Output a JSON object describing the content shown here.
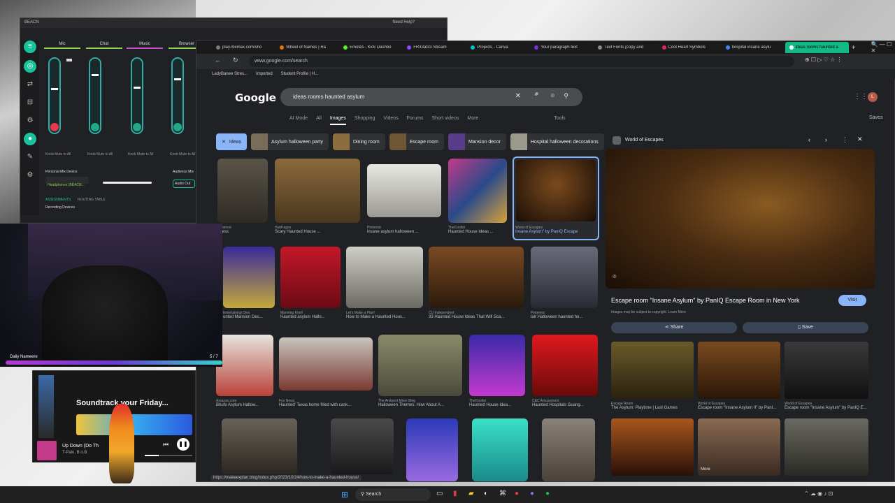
{
  "mixer": {
    "title": "BEACN",
    "help": "Need Help?",
    "channels": [
      "Mic",
      "Chat",
      "Music",
      "Browser"
    ],
    "bottom_labels": [
      "Personal Mix Device",
      "Headphones (BEACN...",
      "Audience Mix",
      "Audio Out",
      "ASSIGNMENTS",
      "ROUTING TABLE",
      "Recording Devices"
    ],
    "small_labels": [
      "Knob Mute to All",
      "Knob Mute to All",
      "Knob Mute to All",
      "Knob Mute to All"
    ]
  },
  "browser": {
    "tabs": [
      {
        "label": "play.rbxmax.com/sho",
        "color": "#7a7a7a"
      },
      {
        "label": "Wheel of Names | Ra",
        "color": "#e8710a"
      },
      {
        "label": "Emotes - Kick Dashbo",
        "color": "#53fc18"
      },
      {
        "label": "FR33at33 Stream",
        "color": "#9146ff"
      },
      {
        "label": "Projects - Canva",
        "color": "#00c4cc"
      },
      {
        "label": "Your paragraph text",
        "color": "#7d2ae8"
      },
      {
        "label": "Text Fonts (copy and",
        "color": "#444"
      },
      {
        "label": "Cool Heart Symbols",
        "color": "#e91e63"
      },
      {
        "label": "hospital insane asylu",
        "color": "#4285f4"
      },
      {
        "label": "ideas rooms haunted a",
        "color": "#000"
      }
    ],
    "url": "www.google.com/search",
    "bookmarks": [
      "LadyBanee Stres...",
      "Imported",
      "Student Profile | H..."
    ],
    "status_url": "https://makeexplan.blog/index.php/2023/10/24/how-to-make-a-haunted-house/"
  },
  "google": {
    "logo": "Google",
    "query": "ideas rooms haunted asylum",
    "tabs": [
      "AI Mode",
      "All",
      "Images",
      "Shopping",
      "Videos",
      "Forums",
      "Short videos",
      "More",
      "Tools"
    ],
    "saves": "Saves",
    "chips": [
      "Ideas",
      "Asylum halloween party",
      "Dining room",
      "Escape room",
      "Mansion decor",
      "Hospital halloween decorations"
    ],
    "results": [
      {
        "src": "Pinterest",
        "title": "stress"
      },
      {
        "src": "HubPages",
        "title": "Scary Haunted House ..."
      },
      {
        "src": "Pinterest",
        "title": "insane asylum halloween ..."
      },
      {
        "src": "TheCoolist",
        "title": "Haunted House Ideas ..."
      },
      {
        "src": "World of Escapes",
        "title": "Insane Asylum\" by PanIQ Escape"
      },
      {
        "src": "Entertaining Diva",
        "title": "unted Mansion Dec..."
      },
      {
        "src": "Manning Knoll",
        "title": "Haunted asylum Hallo..."
      },
      {
        "src": "Let's Make a Plan!",
        "title": "How to Make a Haunted Hous..."
      },
      {
        "src": "CU Independent",
        "title": "33 Haunted House Ideas That Will Sca..."
      },
      {
        "src": "Pinterest",
        "title": "lair Halloween haunted ho..."
      },
      {
        "src": "Amazon.com",
        "title": "Bhufu Asylum Hallow..."
      },
      {
        "src": "Fox News",
        "title": "Haunted' Texas home filled with cask..."
      },
      {
        "src": "The Ambient Mixer Blog",
        "title": "Halloween Themes: How About A..."
      },
      {
        "src": "TheCoolist",
        "title": "Haunted House Idea..."
      },
      {
        "src": "C&C Amusement",
        "title": "Haunted Hospitals Guang..."
      }
    ]
  },
  "panel": {
    "source": "World of Escapes",
    "title": "Escape room \"Insane Asylum\" by PanIQ Escape Room in New York",
    "visit": "Visit",
    "copyright": "Images may be subject to copyright. Learn More",
    "share": "Share",
    "save": "Save",
    "related": [
      {
        "src": "Escape Room",
        "title": "The Asylum: Playtime | Last Games"
      },
      {
        "src": "World of Escapes",
        "title": "Escape room \"Insane Asylum II\" by PanI..."
      },
      {
        "src": "World of Escapes",
        "title": "Escape room \"Insane Asylum\" by PanIQ E..."
      }
    ],
    "more": "More"
  },
  "overlay": {
    "daily": "Daily Nameere",
    "count": "5 / 7",
    "playlist": "Soundtrack your Friday...",
    "song": "Up Down (Do Th",
    "artist": "T-Pain, B.o.B"
  },
  "taskbar": {
    "search": "Search"
  }
}
